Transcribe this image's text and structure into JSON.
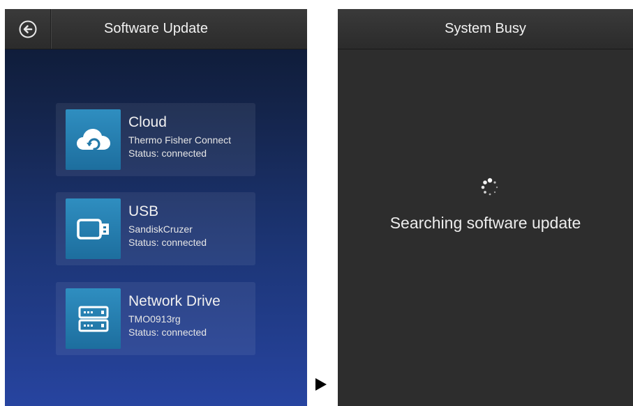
{
  "left_screen": {
    "title": "Software Update",
    "back_icon": "back-arrow-circle-icon",
    "sources": [
      {
        "icon": "cloud-sync-icon",
        "name": "Cloud",
        "detail": "Thermo Fisher Connect",
        "status": "Status: connected"
      },
      {
        "icon": "usb-drive-icon",
        "name": "USB",
        "detail": "SandiskCruzer",
        "status": "Status: connected"
      },
      {
        "icon": "network-drive-icon",
        "name": "Network Drive",
        "detail": "TMO0913rg",
        "status": "Status: connected"
      }
    ]
  },
  "transition_icon": "play-arrow-icon",
  "right_screen": {
    "title": "System Busy",
    "spinner_icon": "loading-spinner-icon",
    "message": "Searching software update"
  },
  "colors": {
    "accent_tile": "#2a86b8",
    "header_bg": "#333333",
    "busy_bg": "#2d2d2d",
    "gradient_top": "#0c1830",
    "gradient_bottom": "#2744a0"
  }
}
